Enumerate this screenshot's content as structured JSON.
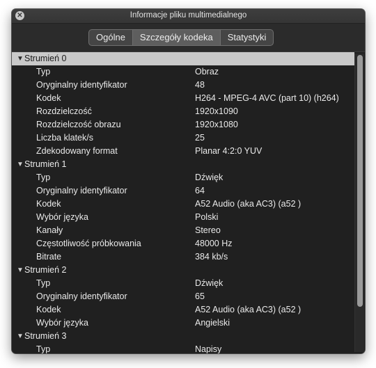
{
  "window": {
    "title": "Informacje pliku multimedialnego"
  },
  "tabs": [
    {
      "label": "Ogólne"
    },
    {
      "label": "Szczegóły kodeka"
    },
    {
      "label": "Statystyki"
    }
  ],
  "streams": [
    {
      "label": "Strumień 0",
      "props": [
        {
          "key": "Typ",
          "value": "Obraz"
        },
        {
          "key": "Oryginalny identyfikator",
          "value": "48"
        },
        {
          "key": "Kodek",
          "value": "H264 - MPEG-4 AVC (part 10) (h264)"
        },
        {
          "key": "Rozdzielczość",
          "value": "1920x1090"
        },
        {
          "key": "Rozdzielczość obrazu",
          "value": "1920x1080"
        },
        {
          "key": "Liczba klatek/s",
          "value": "25"
        },
        {
          "key": "Zdekodowany format",
          "value": "Planar 4:2:0 YUV"
        }
      ]
    },
    {
      "label": "Strumień 1",
      "props": [
        {
          "key": "Typ",
          "value": "Dźwięk"
        },
        {
          "key": "Oryginalny identyfikator",
          "value": "64"
        },
        {
          "key": "Kodek",
          "value": "A52 Audio (aka AC3) (a52 )"
        },
        {
          "key": "Wybór języka",
          "value": "Polski"
        },
        {
          "key": "Kanały",
          "value": "Stereo"
        },
        {
          "key": "Częstotliwość próbkowania",
          "value": "48000 Hz"
        },
        {
          "key": "Bitrate",
          "value": "384 kb/s"
        }
      ]
    },
    {
      "label": "Strumień 2",
      "props": [
        {
          "key": "Typ",
          "value": "Dźwięk"
        },
        {
          "key": "Oryginalny identyfikator",
          "value": "65"
        },
        {
          "key": "Kodek",
          "value": "A52 Audio (aka AC3) (a52 )"
        },
        {
          "key": "Wybór języka",
          "value": "Angielski"
        }
      ]
    },
    {
      "label": "Strumień 3",
      "props": [
        {
          "key": "Typ",
          "value": "Napisy"
        }
      ]
    }
  ],
  "icons": {
    "close": "close-icon",
    "disclosure": "disclosure-triangle-icon"
  }
}
